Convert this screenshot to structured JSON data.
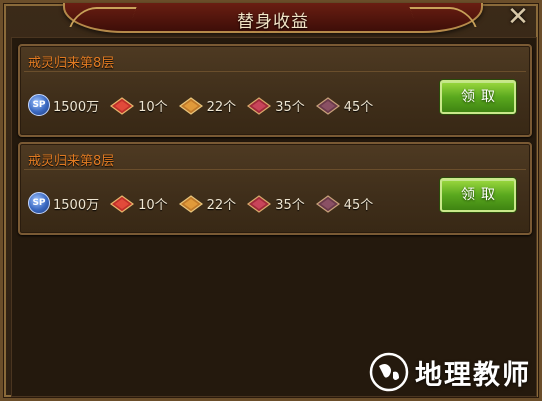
{
  "window": {
    "title": "替身收益",
    "close_glyph": "✕"
  },
  "rows": [
    {
      "title": "戒灵归来第8层",
      "rewards": [
        {
          "icon": "sp-icon",
          "icon_text": "SP",
          "value": "1500万"
        },
        {
          "icon": "red-gem-icon",
          "value": "10个",
          "color": "#c0302a"
        },
        {
          "icon": "orange-gem-icon",
          "value": "22个",
          "color": "#c07a2a"
        },
        {
          "icon": "crimson-gem-icon",
          "value": "35个",
          "color": "#a02a3a"
        },
        {
          "icon": "dark-gem-icon",
          "value": "45个",
          "color": "#6a3a4a"
        }
      ],
      "button": "领取"
    },
    {
      "title": "戒灵归来第8层",
      "rewards": [
        {
          "icon": "sp-icon",
          "icon_text": "SP",
          "value": "1500万"
        },
        {
          "icon": "red-gem-icon",
          "value": "10个",
          "color": "#c0302a"
        },
        {
          "icon": "orange-gem-icon",
          "value": "22个",
          "color": "#c07a2a"
        },
        {
          "icon": "crimson-gem-icon",
          "value": "35个",
          "color": "#a02a3a"
        },
        {
          "icon": "dark-gem-icon",
          "value": "45个",
          "color": "#6a3a4a"
        }
      ],
      "button": "领取"
    }
  ],
  "watermark": {
    "text": "地理教师"
  },
  "colors": {
    "accent_title": "#e07a22",
    "button_green": "#5aa81e"
  }
}
